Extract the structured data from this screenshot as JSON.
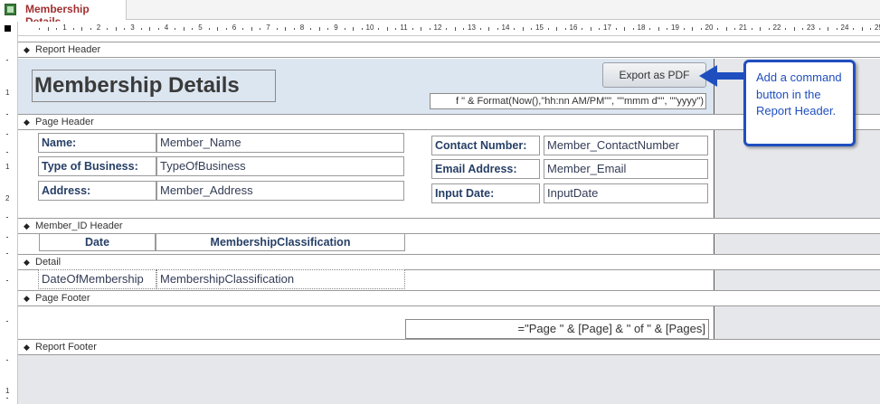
{
  "tab": {
    "title": "Membership Details"
  },
  "ruler": {
    "numbers": [
      "1",
      "2",
      "3",
      "4",
      "5",
      "6",
      "7",
      "8",
      "9",
      "10",
      "11",
      "12",
      "13",
      "14",
      "15",
      "16",
      "17",
      "18",
      "19",
      "20",
      "21",
      "22",
      "23",
      "24",
      "25"
    ],
    "vnumbers": [
      "1",
      "1",
      "2",
      "1"
    ]
  },
  "sections": {
    "report_header": "Report Header",
    "page_header": "Page Header",
    "member_id_header": "Member_ID Header",
    "detail": "Detail",
    "page_footer": "Page Footer",
    "report_footer": "Report Footer"
  },
  "report_header": {
    "title": "Membership Details",
    "export_button": "Export as PDF",
    "date_expression": "f \" & Format(Now(),\"hh:nn AM/PM\"\", \"\"mmm d\"\", \"\"yyyy\")"
  },
  "callout": {
    "text": "Add a command button in the Report Header."
  },
  "page_header": {
    "left": [
      {
        "label": "Name:",
        "field": "Member_Name"
      },
      {
        "label": "Type of Business:",
        "field": "TypeOfBusiness"
      },
      {
        "label": "Address:",
        "field": "Member_Address"
      }
    ],
    "right": [
      {
        "label": "Contact Number:",
        "field": "Member_ContactNumber"
      },
      {
        "label": "Email Address:",
        "field": "Member_Email"
      },
      {
        "label": "Input Date:",
        "field": "InputDate"
      }
    ]
  },
  "member_id_header": {
    "col1": "Date",
    "col2": "MembershipClassification"
  },
  "detail": {
    "field1": "DateOfMembership",
    "field2": "MembershipClassification"
  },
  "page_footer": {
    "expression": "=\"Page \" & [Page] & \" of \" & [Pages]"
  }
}
